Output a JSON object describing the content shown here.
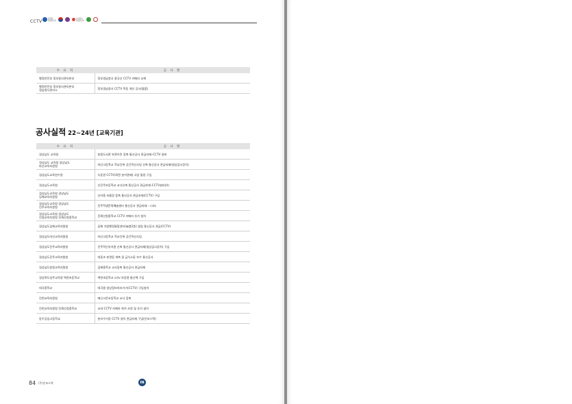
{
  "header": {
    "label": "CCTV",
    "logos": [
      {
        "name": "police-agency",
        "text": "경찰청\n행정안전부",
        "color": "#2a5ea8"
      },
      {
        "name": "taegeuk",
        "text": "",
        "color": "#c4302b"
      },
      {
        "name": "education",
        "text": "",
        "color": "#7a3a8a"
      },
      {
        "name": "korail",
        "text": "나라장터\n행정안전부",
        "color": "#d94a3a"
      },
      {
        "name": "green-leaf",
        "text": "",
        "color": "#3f9a3f"
      },
      {
        "name": "seal",
        "text": "",
        "color": "#c23a3a"
      }
    ]
  },
  "top_table": {
    "headers": [
      "수 요 처",
      "공 사 명"
    ],
    "rows": [
      {
        "client": "행정안전부 정부청사관리본부",
        "project": "정부경남청사 중국산 CCTV 카메라 교체"
      },
      {
        "client": "행정안전부 정부청사관리본부\n경남청사관리소",
        "project": "정부경남청사 CCTV 폭동 개선 공사(물품)"
      }
    ]
  },
  "section": {
    "title": "공사실적",
    "subtitle": "22~24년 [교육기관]"
  },
  "main_table": {
    "headers": [
      "수 요 처",
      "공 사 명"
    ],
    "rows": [
      {
        "client": "경상남도 교육청",
        "project": "창원도서관 본관이전 증축 통신공사 관급자재–CCTV 설비"
      },
      {
        "client": "경상남도 교육청 경상남도\n마산교육지원청",
        "project": "마산고등학교 학교단위 공간혁신사업 신축 통신공사 관급자재(영상감시장치)"
      },
      {
        "client": "경상남도교육연수원",
        "project": "녹동관 CCTV(화면 분석관제) 사업 통용 구입"
      },
      {
        "client": "경상남도교육청",
        "project": "신진주초등학교 교사신축 통신공사 관급자재–CCTV설비(A)"
      },
      {
        "client": "경상남도교육청 경상남도\n김해교육지원청",
        "project": "신어중 씨름장 증축 통신공사 관급자재(CCTV) 구입"
      },
      {
        "client": "경상남도교육청 경상남도\n진주교육지원청",
        "project": "진주학생문화예술센터 통신공사 관급자재 – cctv"
      },
      {
        "client": "경상남도교육청 경상남도\n진영교육지원청 진례산청중학교",
        "project": "진례산청중학교 CCTV 카메라 추가 설치"
      },
      {
        "client": "경상남도김해교육지원청",
        "project": "김해 가람행정통합센터(늘봄2층) 설립 통신공사 관급(CCTV)"
      },
      {
        "client": "경상남도마산교육지원청",
        "project": "마산고등학교 학교단위 공간혁신사업"
      },
      {
        "client": "경상남도진주교육지원청",
        "project": "진주학신유치원 신축 통신공사 관급자재(영상감시장치) 구입"
      },
      {
        "client": "경상남도진주교육지원청",
        "project": "대동초 본관동 개축 및 급식소동 보수 통신공사"
      },
      {
        "client": "경상남도창원교육지원청",
        "project": "김해중학교 교사증축 통신공사 관급자재"
      },
      {
        "client": "경상북도성주교육청 백천초등학교",
        "project": "백천초등학교 cctv 보강용 통신책 구입"
      },
      {
        "client": "대곡중학교",
        "project": "대곡중 영상정보처리기기(CCTV) 구입설치"
      },
      {
        "client": "진천교육지원청",
        "project": "매산고운초등학교 교사 증축"
      },
      {
        "client": "진천교육지원청 진례산청중학교",
        "project": "교내 CCTV 카메라 위치 조정 및 추가 설치"
      },
      {
        "client": "동우공업고등학교",
        "project": "분리수거장 CCTV 설치 관급자재 구입(인포스텍)"
      }
    ]
  },
  "footer": {
    "page_number": "84",
    "company": "(주)인포스텍",
    "emblem_text": "IN"
  }
}
